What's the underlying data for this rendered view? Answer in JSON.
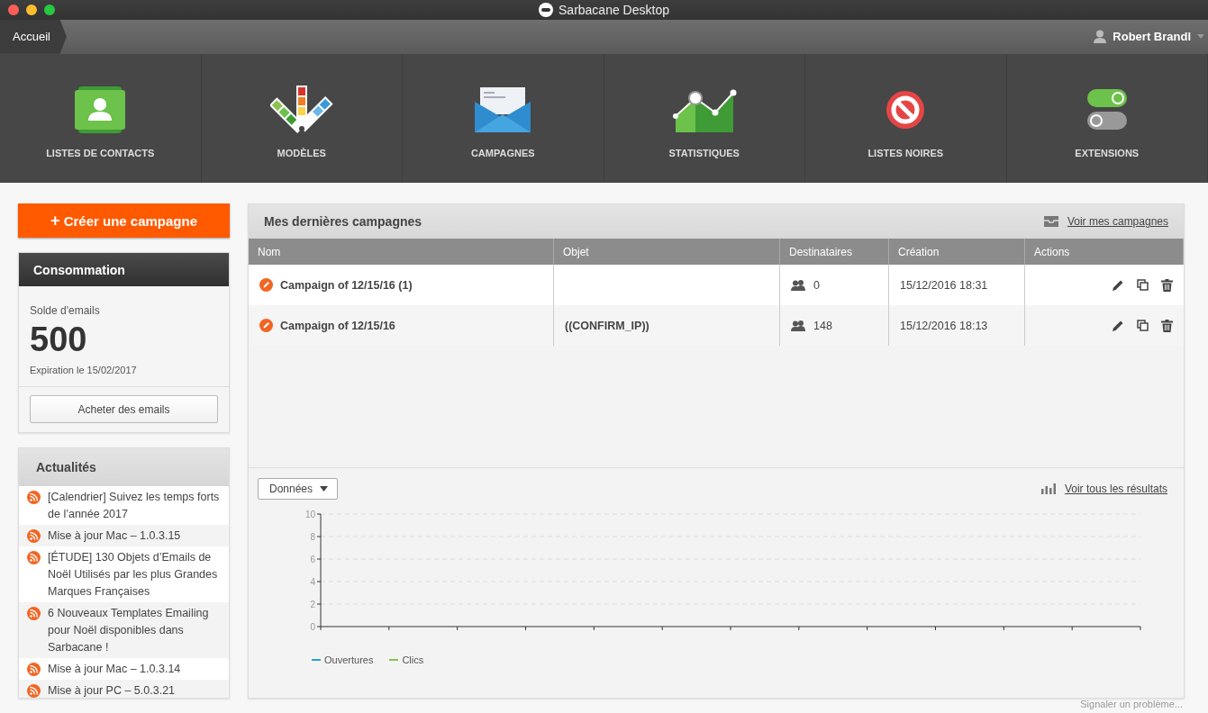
{
  "window": {
    "title": "Sarbacane Desktop"
  },
  "breadcrumb": {
    "label": "Accueil"
  },
  "user": {
    "name": "Robert Brandl"
  },
  "nav": [
    {
      "label": "LISTES DE CONTACTS",
      "kind": "contacts"
    },
    {
      "label": "MODÈLES",
      "kind": "templates"
    },
    {
      "label": "CAMPAGNES",
      "kind": "campaigns"
    },
    {
      "label": "STATISTIQUES",
      "kind": "stats"
    },
    {
      "label": "LISTES NOIRES",
      "kind": "blacklist"
    },
    {
      "label": "EXTENSIONS",
      "kind": "extensions"
    }
  ],
  "create_button": {
    "icon": "+",
    "label": "Créer une campagne"
  },
  "consumption": {
    "title": "Consommation",
    "balance_label": "Solde d'emails",
    "balance": "500",
    "expiration": "Expiration le 15/02/2017",
    "buy_button": "Acheter des emails"
  },
  "news": {
    "title": "Actualités",
    "items": [
      {
        "text": "[Calendrier] Suivez les temps forts de l’année 2017"
      },
      {
        "text": "Mise à jour Mac – 1.0.3.15"
      },
      {
        "text": "[ÉTUDE] 130 Objets d’Emails de Noël Utilisés par les plus Grandes Marques Françaises"
      },
      {
        "text": "6 Nouveaux Templates Emailing pour Noël disponibles dans Sarbacane !"
      },
      {
        "text": "Mise à jour Mac – 1.0.3.14"
      },
      {
        "text": "Mise à jour PC – 5.0.3.21"
      }
    ]
  },
  "campaigns": {
    "title": "Mes dernières campagnes",
    "link": "Voir mes campagnes",
    "columns": [
      "Nom",
      "Objet",
      "Destinataires",
      "Création",
      "Actions"
    ],
    "rows": [
      {
        "name": "Campaign of 12/15/16 (1)",
        "subject": "",
        "recipients": "0",
        "created": "15/12/2016 18:31"
      },
      {
        "name": "Campaign of 12/15/16",
        "subject": "((CONFIRM_IP))",
        "recipients": "148",
        "created": "15/12/2016 18:13"
      }
    ]
  },
  "results": {
    "dropdown": "Données",
    "link": "Voir tous les résultats",
    "chart_data": {
      "type": "line",
      "grid": true,
      "ylim": [
        0,
        10
      ],
      "yticks": [
        0,
        2,
        4,
        6,
        8,
        10
      ],
      "series": [
        {
          "name": "Ouvertures",
          "color": "#2a9fd6"
        },
        {
          "name": "Clics",
          "color": "#8cc152"
        }
      ]
    }
  },
  "footer": {
    "link": "Signaler un problème..."
  }
}
